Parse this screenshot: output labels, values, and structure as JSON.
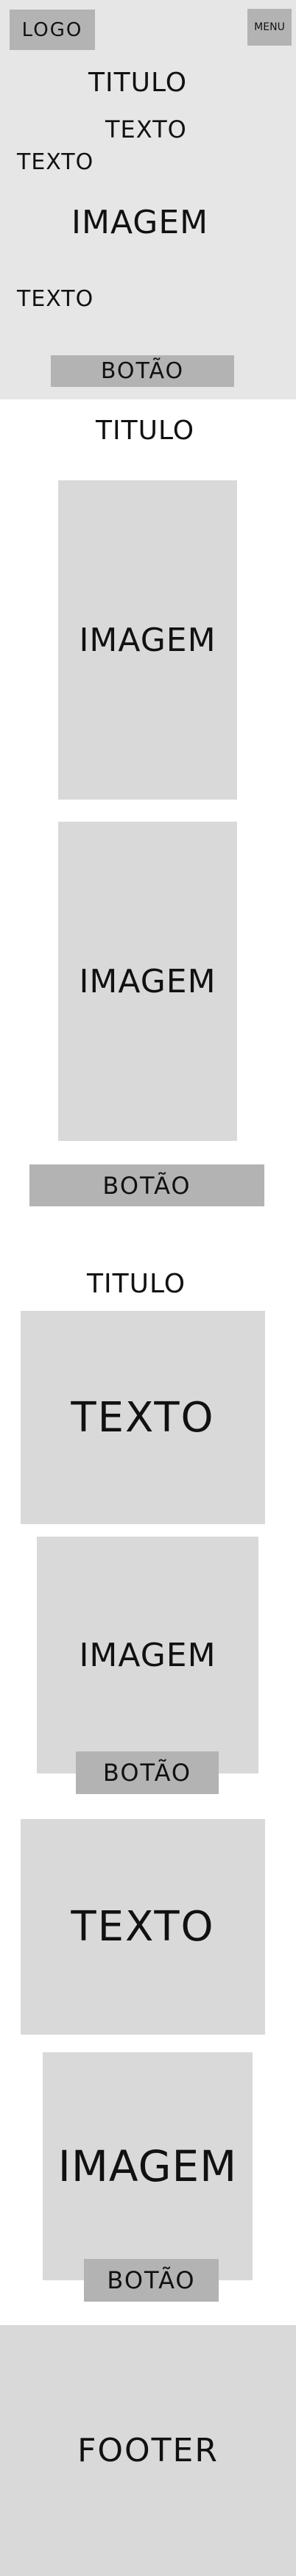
{
  "header": {
    "logo": "LOGO",
    "menu": "MENU"
  },
  "hero": {
    "title": "TITULO",
    "text_right": "TEXTO",
    "text_left": "TEXTO",
    "image": "IMAGEM",
    "text_bottom": "TEXTO",
    "button": "BOTÃO"
  },
  "section1": {
    "title": "TITULO",
    "image1": "IMAGEM",
    "image2": "IMAGEM",
    "button": "BOTÃO"
  },
  "section2": {
    "title": "TITULO",
    "text1": "TEXTO",
    "image1": "IMAGEM",
    "button1": "BOTÃO",
    "text2": "TEXTO",
    "image2": "IMAGEM",
    "button2": "BOTÃO"
  },
  "footer": {
    "label": "FOOTER"
  }
}
